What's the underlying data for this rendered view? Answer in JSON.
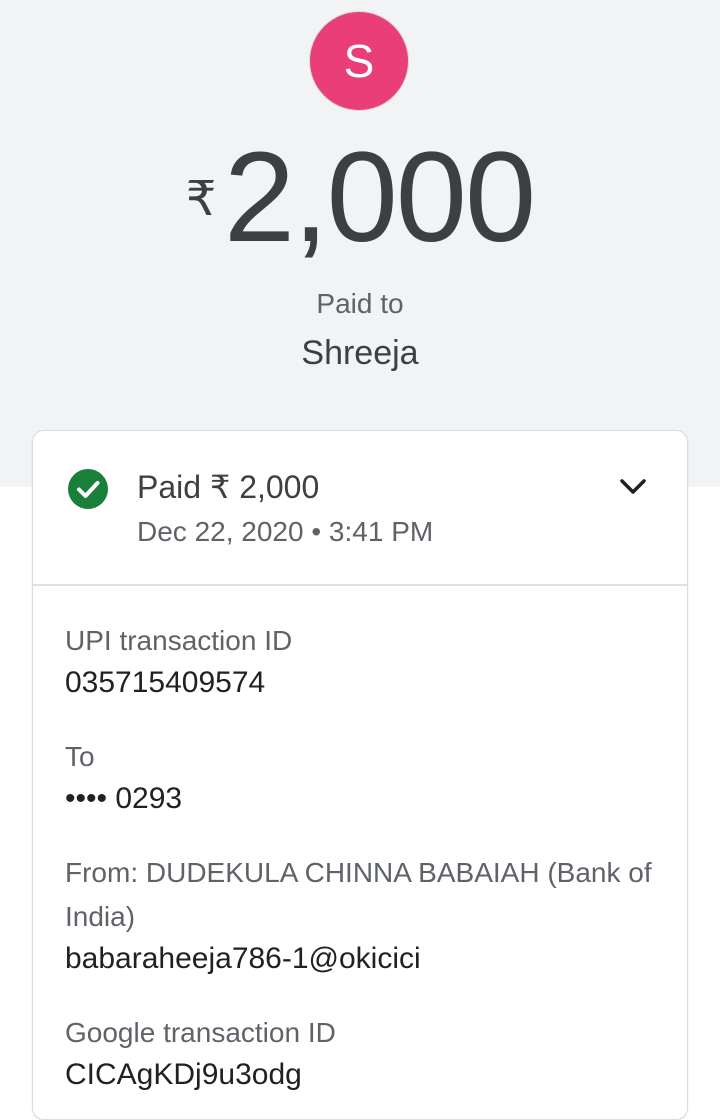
{
  "header": {
    "avatar_initial": "S",
    "avatar_color": "#ea3e78",
    "currency_symbol": "₹",
    "amount": "2,000",
    "paid_to_label": "Paid to",
    "payee_name": "Shreeja"
  },
  "status": {
    "icon": "check-circle-icon",
    "icon_color": "#188038",
    "title": "Paid ₹ 2,000",
    "date": "Dec 22, 2020",
    "separator": "•",
    "time": "3:41 PM",
    "date_time": "Dec 22, 2020 • 3:41 PM",
    "expand_icon": "chevron-down-icon"
  },
  "details": [
    {
      "label": "UPI transaction ID",
      "value": "035715409574"
    },
    {
      "label": "To",
      "value": "•••• 0293"
    },
    {
      "label": "From: DUDEKULA CHINNA BABAIAH (Bank of India)",
      "value": "babaraheeja786-1@okicici"
    },
    {
      "label": "Google transaction ID",
      "value": "CICAgKDj9u3odg"
    }
  ]
}
